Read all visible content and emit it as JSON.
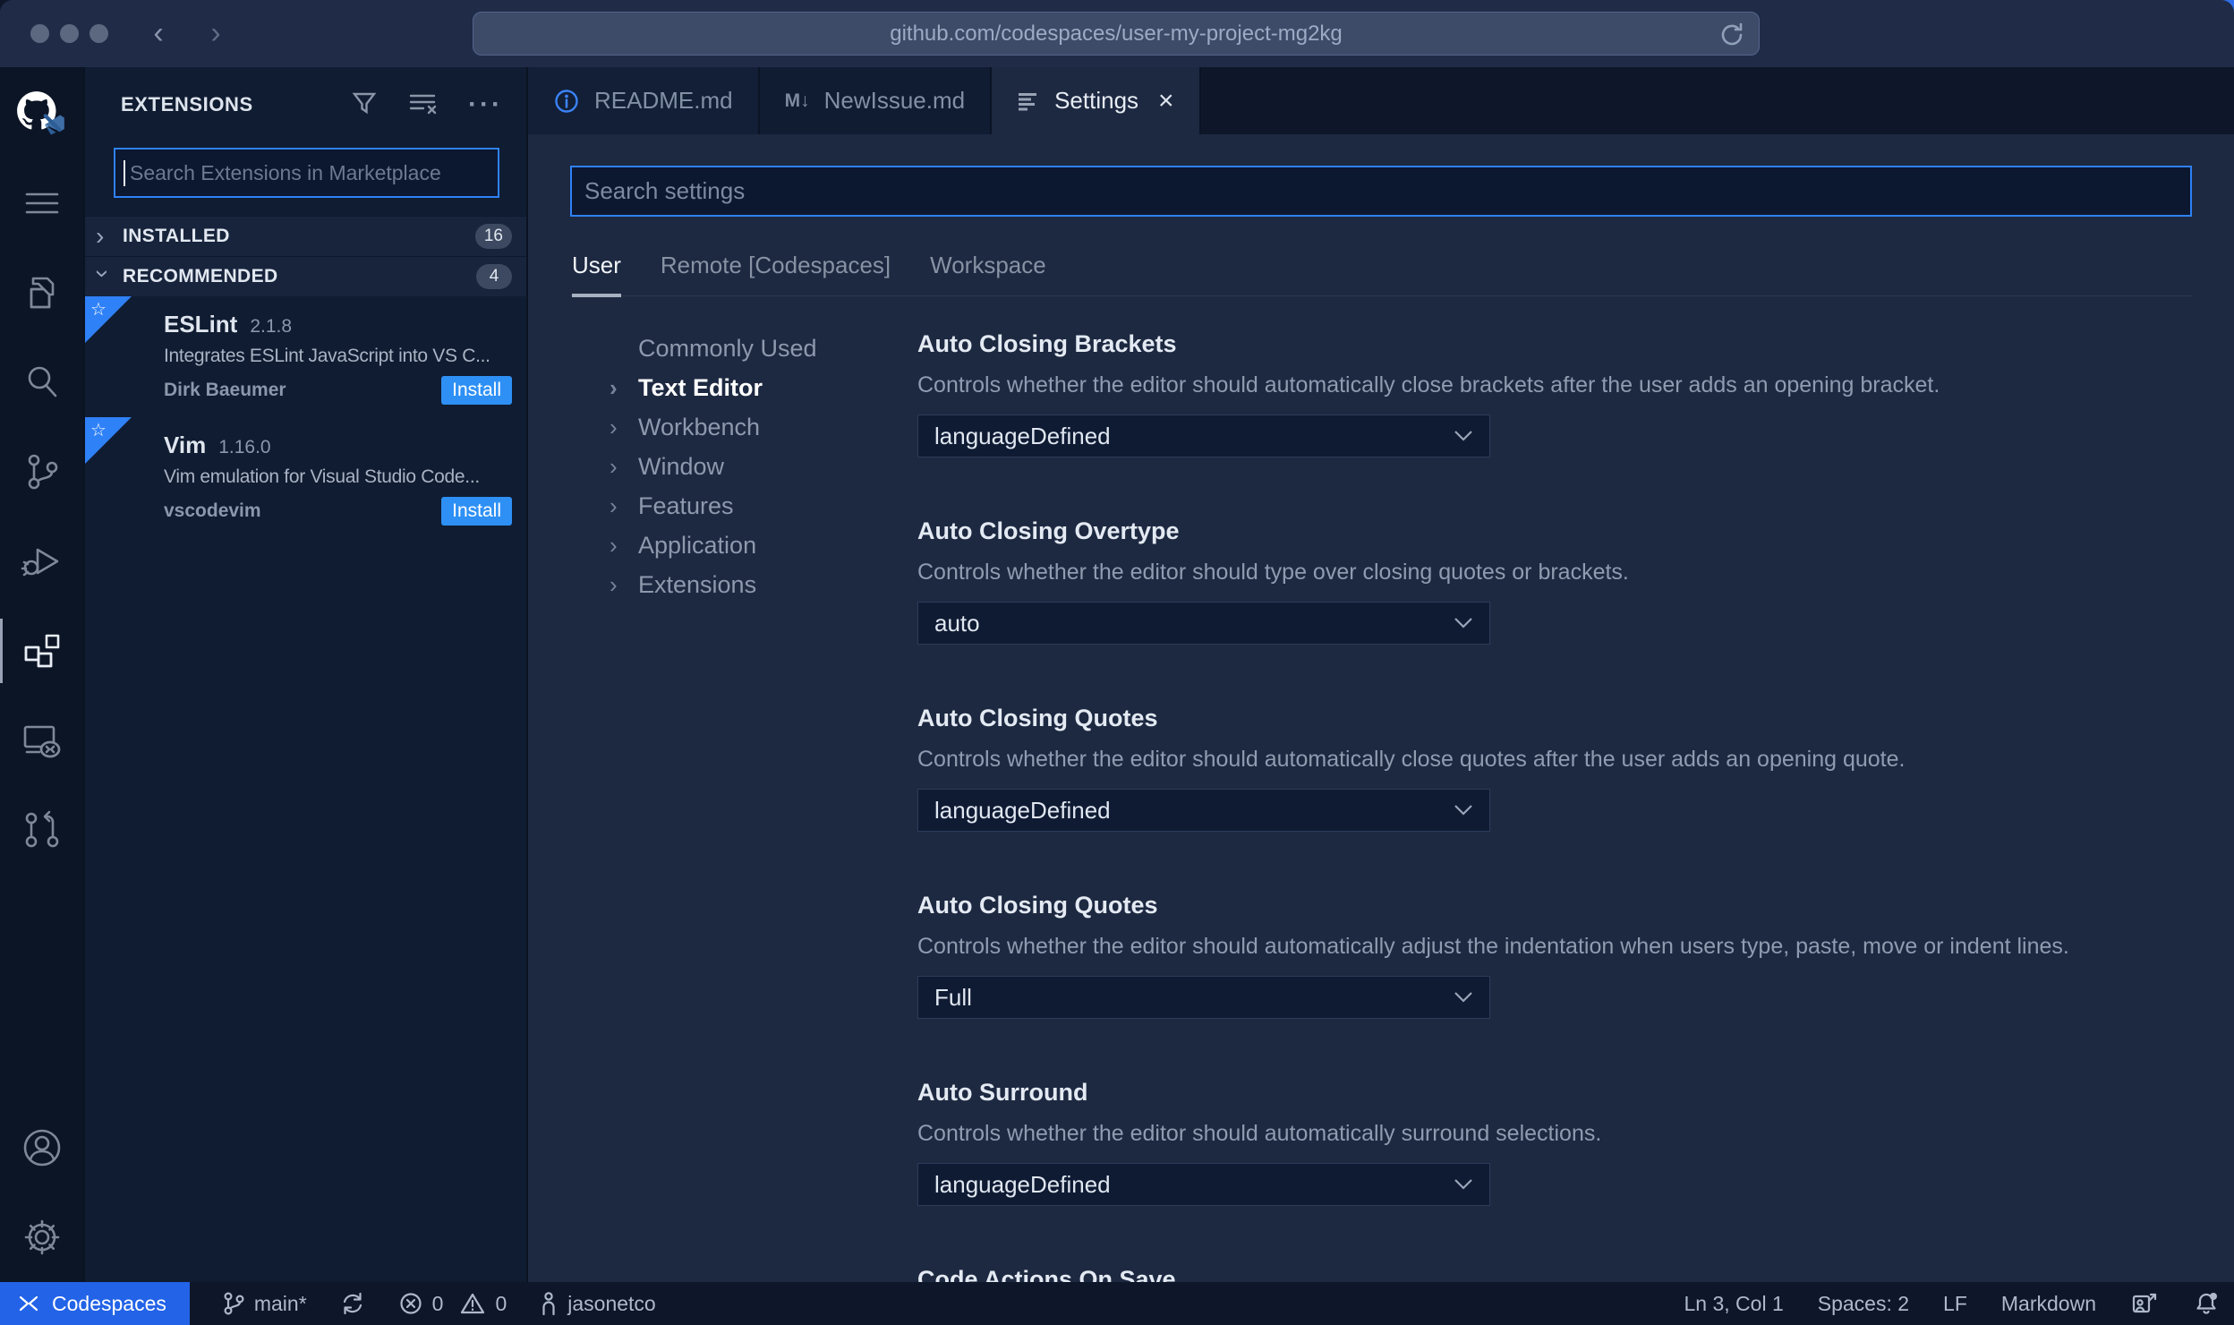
{
  "browser": {
    "url": "github.com/codespaces/user-my-project-mg2kg"
  },
  "icons": {
    "more": "···",
    "close": "×",
    "chevron_right": "›",
    "star": "☆",
    "markdown": "M↓"
  },
  "colors": {
    "accent_blue": "#2f81f7",
    "install_blue": "#2e90f5",
    "codespaces_blue": "#2263e7",
    "editor_bg": "#1d2941",
    "sidebar_bg": "#101c31",
    "statusbar_bg": "#0d1729"
  },
  "sidebar": {
    "title": "EXTENSIONS",
    "search_placeholder": "Search Extensions in Marketplace",
    "sections": [
      {
        "label": "INSTALLED",
        "count": "16"
      },
      {
        "label": "RECOMMENDED",
        "count": "4"
      }
    ],
    "extensions": [
      {
        "name": "ESLint",
        "version": "2.1.8",
        "description": "Integrates ESLint JavaScript into VS C...",
        "publisher": "Dirk Baeumer",
        "action": "Install"
      },
      {
        "name": "Vim",
        "version": "1.16.0",
        "description": "Vim emulation for Visual Studio Code...",
        "publisher": "vscodevim",
        "action": "Install"
      }
    ]
  },
  "tabs": [
    {
      "label": "README.md"
    },
    {
      "label": "NewIssue.md"
    },
    {
      "label": "Settings"
    }
  ],
  "settings": {
    "search_placeholder": "Search settings",
    "scopes": [
      {
        "label": "User"
      },
      {
        "label": "Remote [Codespaces]"
      },
      {
        "label": "Workspace"
      }
    ],
    "toc": [
      {
        "label": "Commonly Used"
      },
      {
        "label": "Text Editor"
      },
      {
        "label": "Workbench"
      },
      {
        "label": "Window"
      },
      {
        "label": "Features"
      },
      {
        "label": "Application"
      },
      {
        "label": "Extensions"
      }
    ],
    "items": [
      {
        "title": "Auto Closing Brackets",
        "description": "Controls whether the editor should automatically close brackets after the user adds an opening bracket.",
        "value": "languageDefined"
      },
      {
        "title": "Auto Closing Overtype",
        "description": "Controls whether the editor should type over closing quotes or brackets.",
        "value": "auto"
      },
      {
        "title": "Auto Closing Quotes",
        "description": "Controls whether the editor should automatically close quotes after the user adds an opening quote.",
        "value": "languageDefined"
      },
      {
        "title": "Auto Closing Quotes",
        "description": "Controls whether the editor should automatically adjust the indentation when users type, paste, move or indent lines.",
        "value": "Full"
      },
      {
        "title": "Auto Surround",
        "description": "Controls whether the editor should automatically surround selections.",
        "value": "languageDefined"
      },
      {
        "title": "Code Actions On Save"
      }
    ]
  },
  "status_bar": {
    "codespaces": "Codespaces",
    "branch": "main*",
    "errors": "0",
    "warnings": "0",
    "user": "jasonetco",
    "cursor": "Ln 3, Col 1",
    "indent": "Spaces: 2",
    "eol": "LF",
    "language": "Markdown"
  }
}
